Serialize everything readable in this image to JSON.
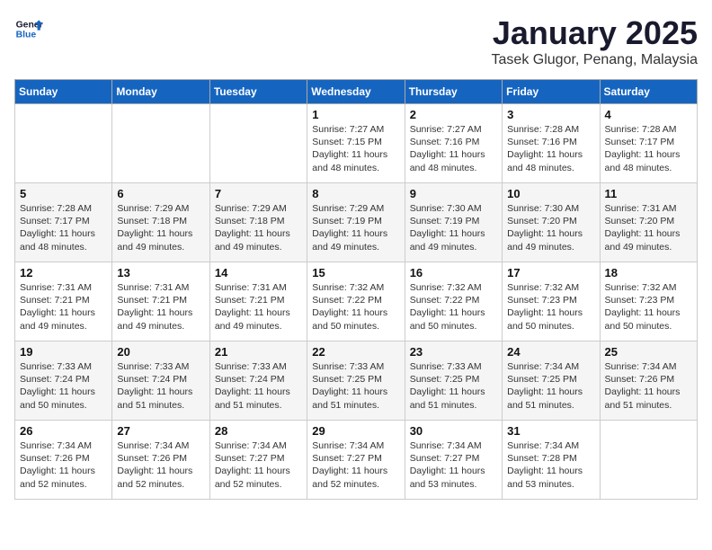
{
  "logo": {
    "general": "General",
    "blue": "Blue"
  },
  "header": {
    "month": "January 2025",
    "location": "Tasek Glugor, Penang, Malaysia"
  },
  "weekdays": [
    "Sunday",
    "Monday",
    "Tuesday",
    "Wednesday",
    "Thursday",
    "Friday",
    "Saturday"
  ],
  "weeks": [
    [
      {
        "day": "",
        "info": ""
      },
      {
        "day": "",
        "info": ""
      },
      {
        "day": "",
        "info": ""
      },
      {
        "day": "1",
        "sunrise": "7:27 AM",
        "sunset": "7:15 PM",
        "daylight": "11 hours and 48 minutes."
      },
      {
        "day": "2",
        "sunrise": "7:27 AM",
        "sunset": "7:16 PM",
        "daylight": "11 hours and 48 minutes."
      },
      {
        "day": "3",
        "sunrise": "7:28 AM",
        "sunset": "7:16 PM",
        "daylight": "11 hours and 48 minutes."
      },
      {
        "day": "4",
        "sunrise": "7:28 AM",
        "sunset": "7:17 PM",
        "daylight": "11 hours and 48 minutes."
      }
    ],
    [
      {
        "day": "5",
        "sunrise": "7:28 AM",
        "sunset": "7:17 PM",
        "daylight": "11 hours and 48 minutes."
      },
      {
        "day": "6",
        "sunrise": "7:29 AM",
        "sunset": "7:18 PM",
        "daylight": "11 hours and 49 minutes."
      },
      {
        "day": "7",
        "sunrise": "7:29 AM",
        "sunset": "7:18 PM",
        "daylight": "11 hours and 49 minutes."
      },
      {
        "day": "8",
        "sunrise": "7:29 AM",
        "sunset": "7:19 PM",
        "daylight": "11 hours and 49 minutes."
      },
      {
        "day": "9",
        "sunrise": "7:30 AM",
        "sunset": "7:19 PM",
        "daylight": "11 hours and 49 minutes."
      },
      {
        "day": "10",
        "sunrise": "7:30 AM",
        "sunset": "7:20 PM",
        "daylight": "11 hours and 49 minutes."
      },
      {
        "day": "11",
        "sunrise": "7:31 AM",
        "sunset": "7:20 PM",
        "daylight": "11 hours and 49 minutes."
      }
    ],
    [
      {
        "day": "12",
        "sunrise": "7:31 AM",
        "sunset": "7:21 PM",
        "daylight": "11 hours and 49 minutes."
      },
      {
        "day": "13",
        "sunrise": "7:31 AM",
        "sunset": "7:21 PM",
        "daylight": "11 hours and 49 minutes."
      },
      {
        "day": "14",
        "sunrise": "7:31 AM",
        "sunset": "7:21 PM",
        "daylight": "11 hours and 49 minutes."
      },
      {
        "day": "15",
        "sunrise": "7:32 AM",
        "sunset": "7:22 PM",
        "daylight": "11 hours and 50 minutes."
      },
      {
        "day": "16",
        "sunrise": "7:32 AM",
        "sunset": "7:22 PM",
        "daylight": "11 hours and 50 minutes."
      },
      {
        "day": "17",
        "sunrise": "7:32 AM",
        "sunset": "7:23 PM",
        "daylight": "11 hours and 50 minutes."
      },
      {
        "day": "18",
        "sunrise": "7:32 AM",
        "sunset": "7:23 PM",
        "daylight": "11 hours and 50 minutes."
      }
    ],
    [
      {
        "day": "19",
        "sunrise": "7:33 AM",
        "sunset": "7:24 PM",
        "daylight": "11 hours and 50 minutes."
      },
      {
        "day": "20",
        "sunrise": "7:33 AM",
        "sunset": "7:24 PM",
        "daylight": "11 hours and 51 minutes."
      },
      {
        "day": "21",
        "sunrise": "7:33 AM",
        "sunset": "7:24 PM",
        "daylight": "11 hours and 51 minutes."
      },
      {
        "day": "22",
        "sunrise": "7:33 AM",
        "sunset": "7:25 PM",
        "daylight": "11 hours and 51 minutes."
      },
      {
        "day": "23",
        "sunrise": "7:33 AM",
        "sunset": "7:25 PM",
        "daylight": "11 hours and 51 minutes."
      },
      {
        "day": "24",
        "sunrise": "7:34 AM",
        "sunset": "7:25 PM",
        "daylight": "11 hours and 51 minutes."
      },
      {
        "day": "25",
        "sunrise": "7:34 AM",
        "sunset": "7:26 PM",
        "daylight": "11 hours and 51 minutes."
      }
    ],
    [
      {
        "day": "26",
        "sunrise": "7:34 AM",
        "sunset": "7:26 PM",
        "daylight": "11 hours and 52 minutes."
      },
      {
        "day": "27",
        "sunrise": "7:34 AM",
        "sunset": "7:26 PM",
        "daylight": "11 hours and 52 minutes."
      },
      {
        "day": "28",
        "sunrise": "7:34 AM",
        "sunset": "7:27 PM",
        "daylight": "11 hours and 52 minutes."
      },
      {
        "day": "29",
        "sunrise": "7:34 AM",
        "sunset": "7:27 PM",
        "daylight": "11 hours and 52 minutes."
      },
      {
        "day": "30",
        "sunrise": "7:34 AM",
        "sunset": "7:27 PM",
        "daylight": "11 hours and 53 minutes."
      },
      {
        "day": "31",
        "sunrise": "7:34 AM",
        "sunset": "7:28 PM",
        "daylight": "11 hours and 53 minutes."
      },
      {
        "day": "",
        "info": ""
      }
    ]
  ],
  "labels": {
    "sunrise": "Sunrise:",
    "sunset": "Sunset:",
    "daylight": "Daylight:"
  }
}
